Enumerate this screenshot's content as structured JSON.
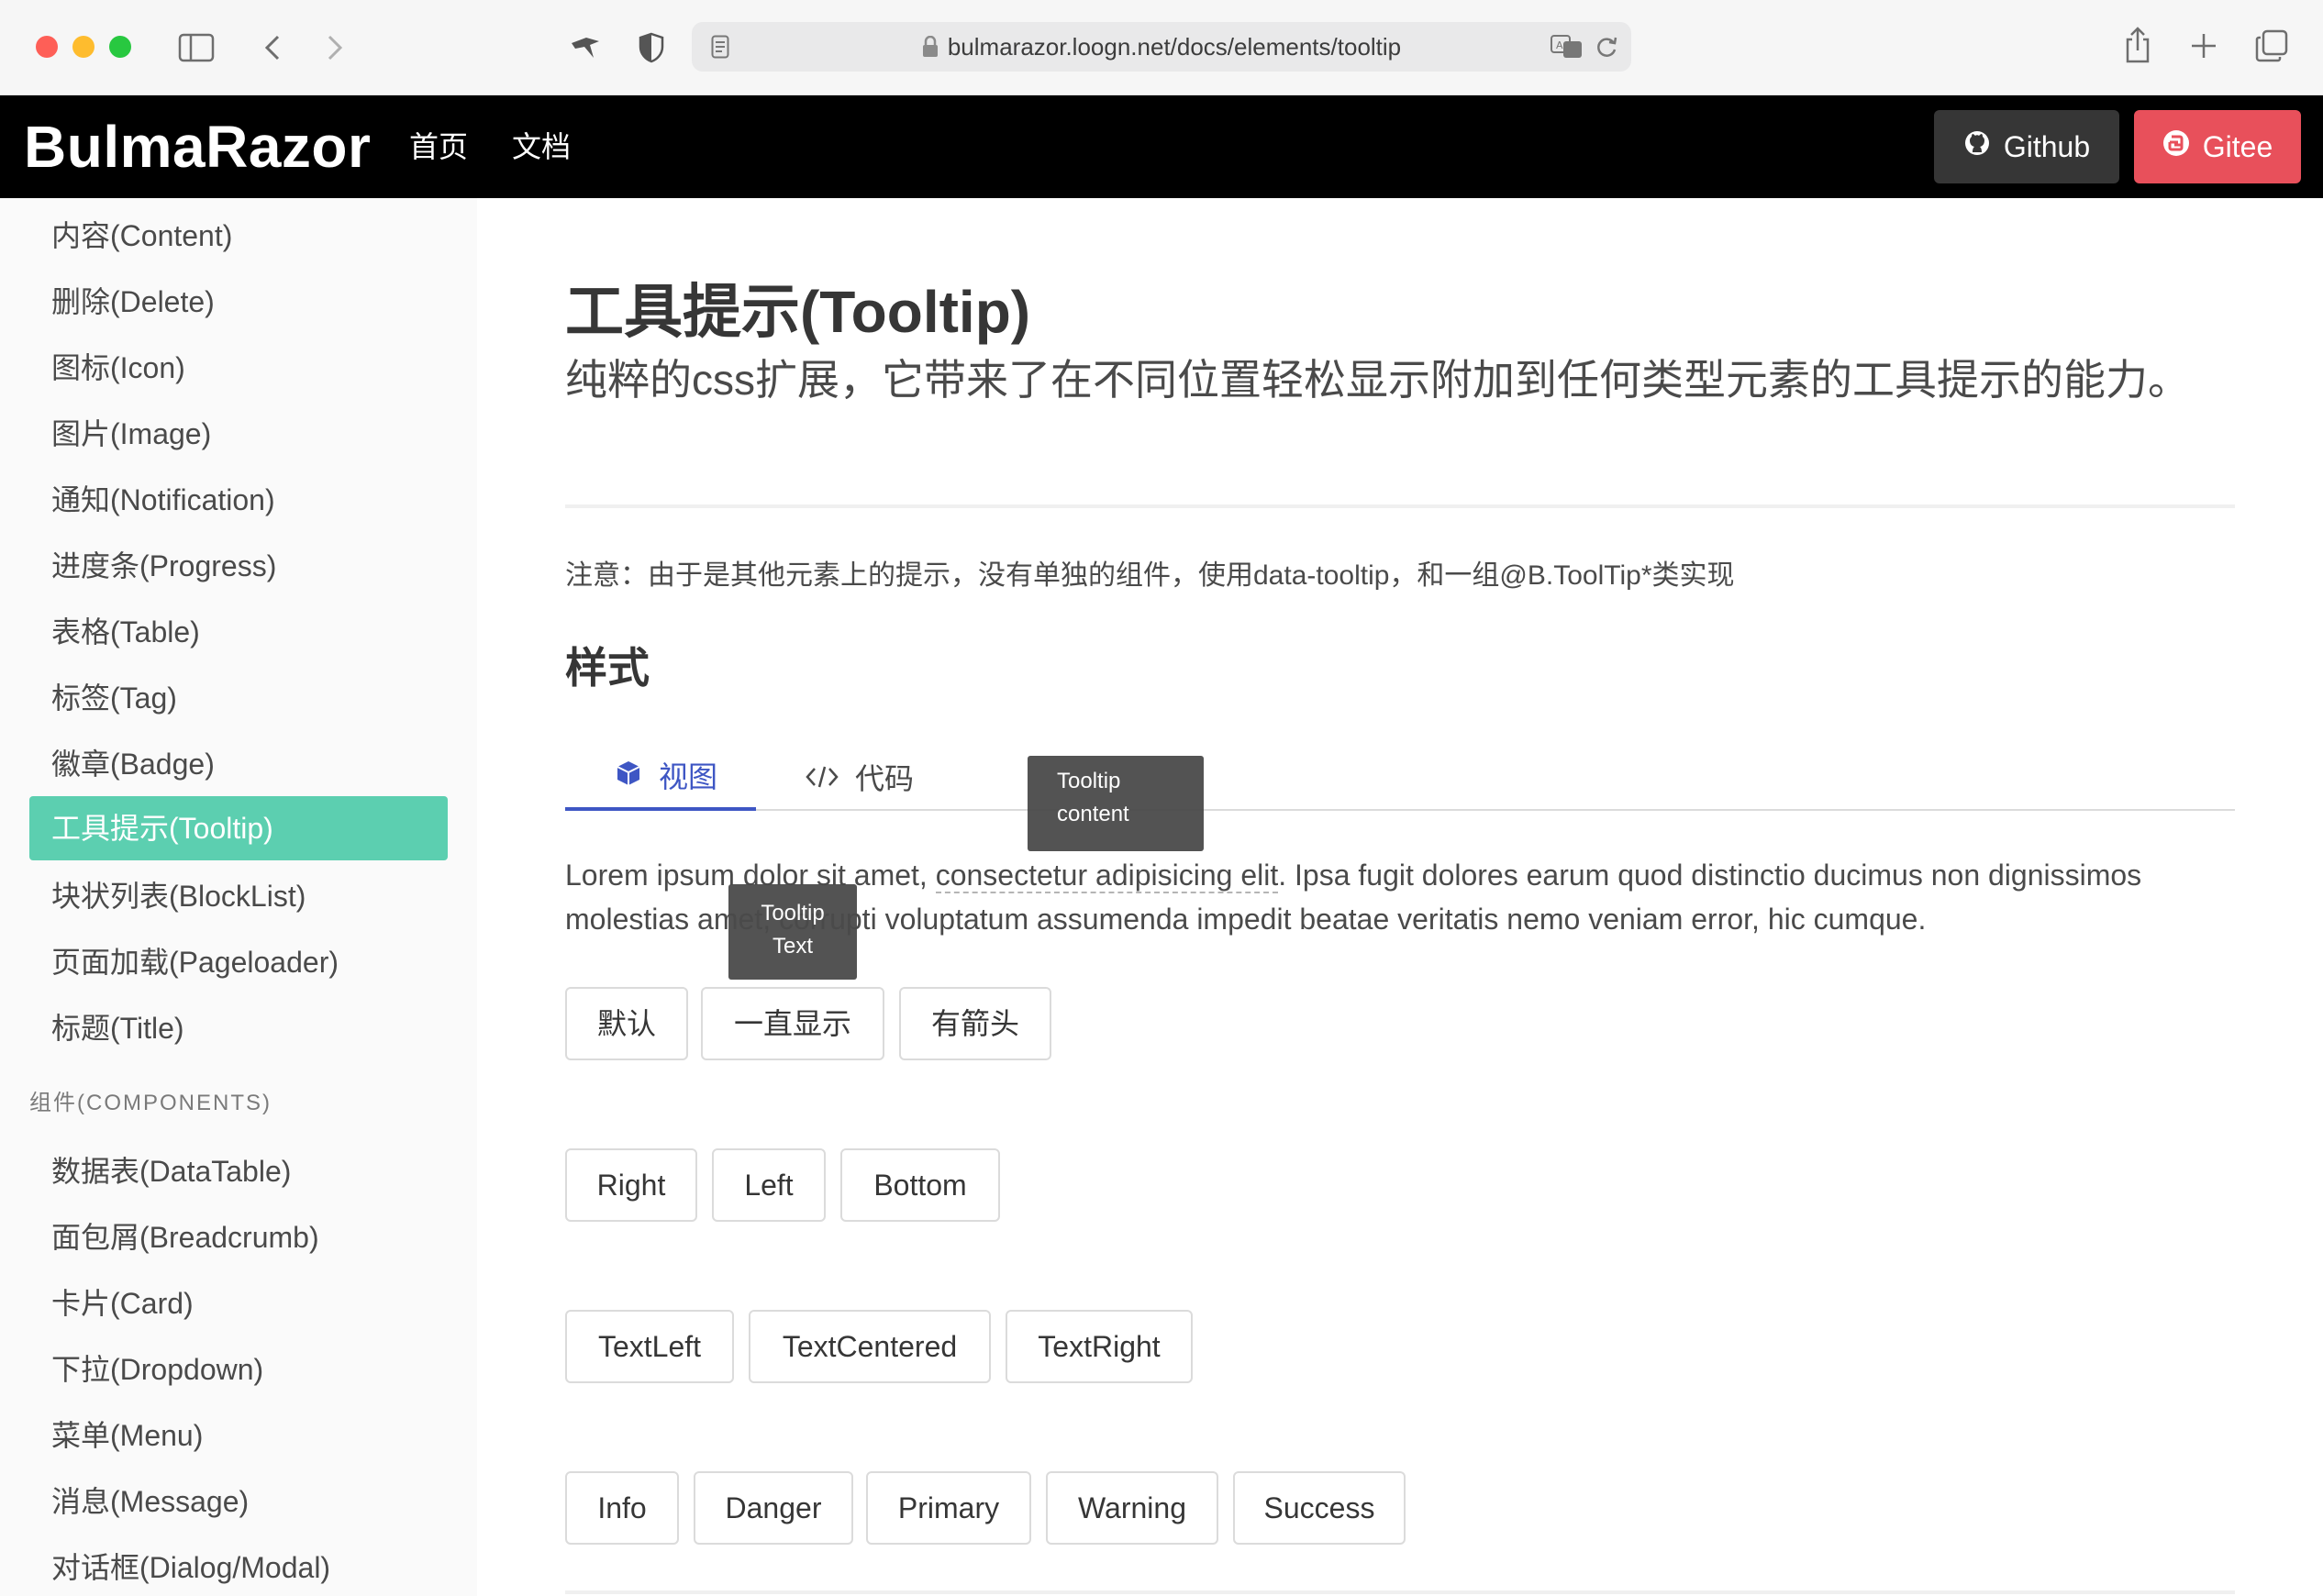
{
  "browser": {
    "url": "bulmarazor.loogn.net/docs/elements/tooltip"
  },
  "navbar": {
    "brand": "BulmaRazor",
    "links": [
      "首页",
      "文档"
    ],
    "github_label": "Github",
    "gitee_label": "Gitee"
  },
  "sidebar": {
    "items": [
      "内容(Content)",
      "删除(Delete)",
      "图标(Icon)",
      "图片(Image)",
      "通知(Notification)",
      "进度条(Progress)",
      "表格(Table)",
      "标签(Tag)",
      "徽章(Badge)",
      "工具提示(Tooltip)",
      "块状列表(BlockList)",
      "页面加载(Pageloader)",
      "标题(Title)"
    ],
    "components_label": "组件(COMPONENTS)",
    "component_items": [
      "数据表(DataTable)",
      "面包屑(Breadcrumb)",
      "卡片(Card)",
      "下拉(Dropdown)",
      "菜单(Menu)",
      "消息(Message)",
      "对话框(Dialog/Modal)"
    ],
    "active_index": 9
  },
  "main": {
    "title": "工具提示(Tooltip)",
    "subtitle": "纯粹的css扩展，它带来了在不同位置轻松显示附加到任何类型元素的工具提示的能力。",
    "note": "注意：由于是其他元素上的提示，没有单独的组件，使用data-tooltip，和一组@B.ToolTip*类实现",
    "section_title": "样式",
    "tabs": [
      {
        "label": "视图",
        "icon": "cube-icon"
      },
      {
        "label": "代码",
        "icon": "code-icon"
      }
    ],
    "tooltip_content": [
      "Tooltip",
      "content"
    ],
    "tooltip_text": [
      "Tooltip",
      "Text"
    ],
    "paragraph": {
      "part1": "Lorem ipsum dolor sit amet, ",
      "link1": "consectetur adipisicing elit",
      "part2": ". Ipsa fugit dolores earum quod distinctio ducimus non dignissimos molestias amet, corrupti voluptatum assumenda impedit beatae veritatis nemo veniam error, hic cumque."
    },
    "button_rows": [
      [
        "默认",
        "一直显示",
        "有箭头"
      ],
      [
        "Right",
        "Left",
        "Bottom"
      ],
      [
        "TextLeft",
        "TextCentered",
        "TextRight"
      ],
      [
        "Info",
        "Danger",
        "Primary",
        "Warning",
        "Success"
      ]
    ]
  }
}
